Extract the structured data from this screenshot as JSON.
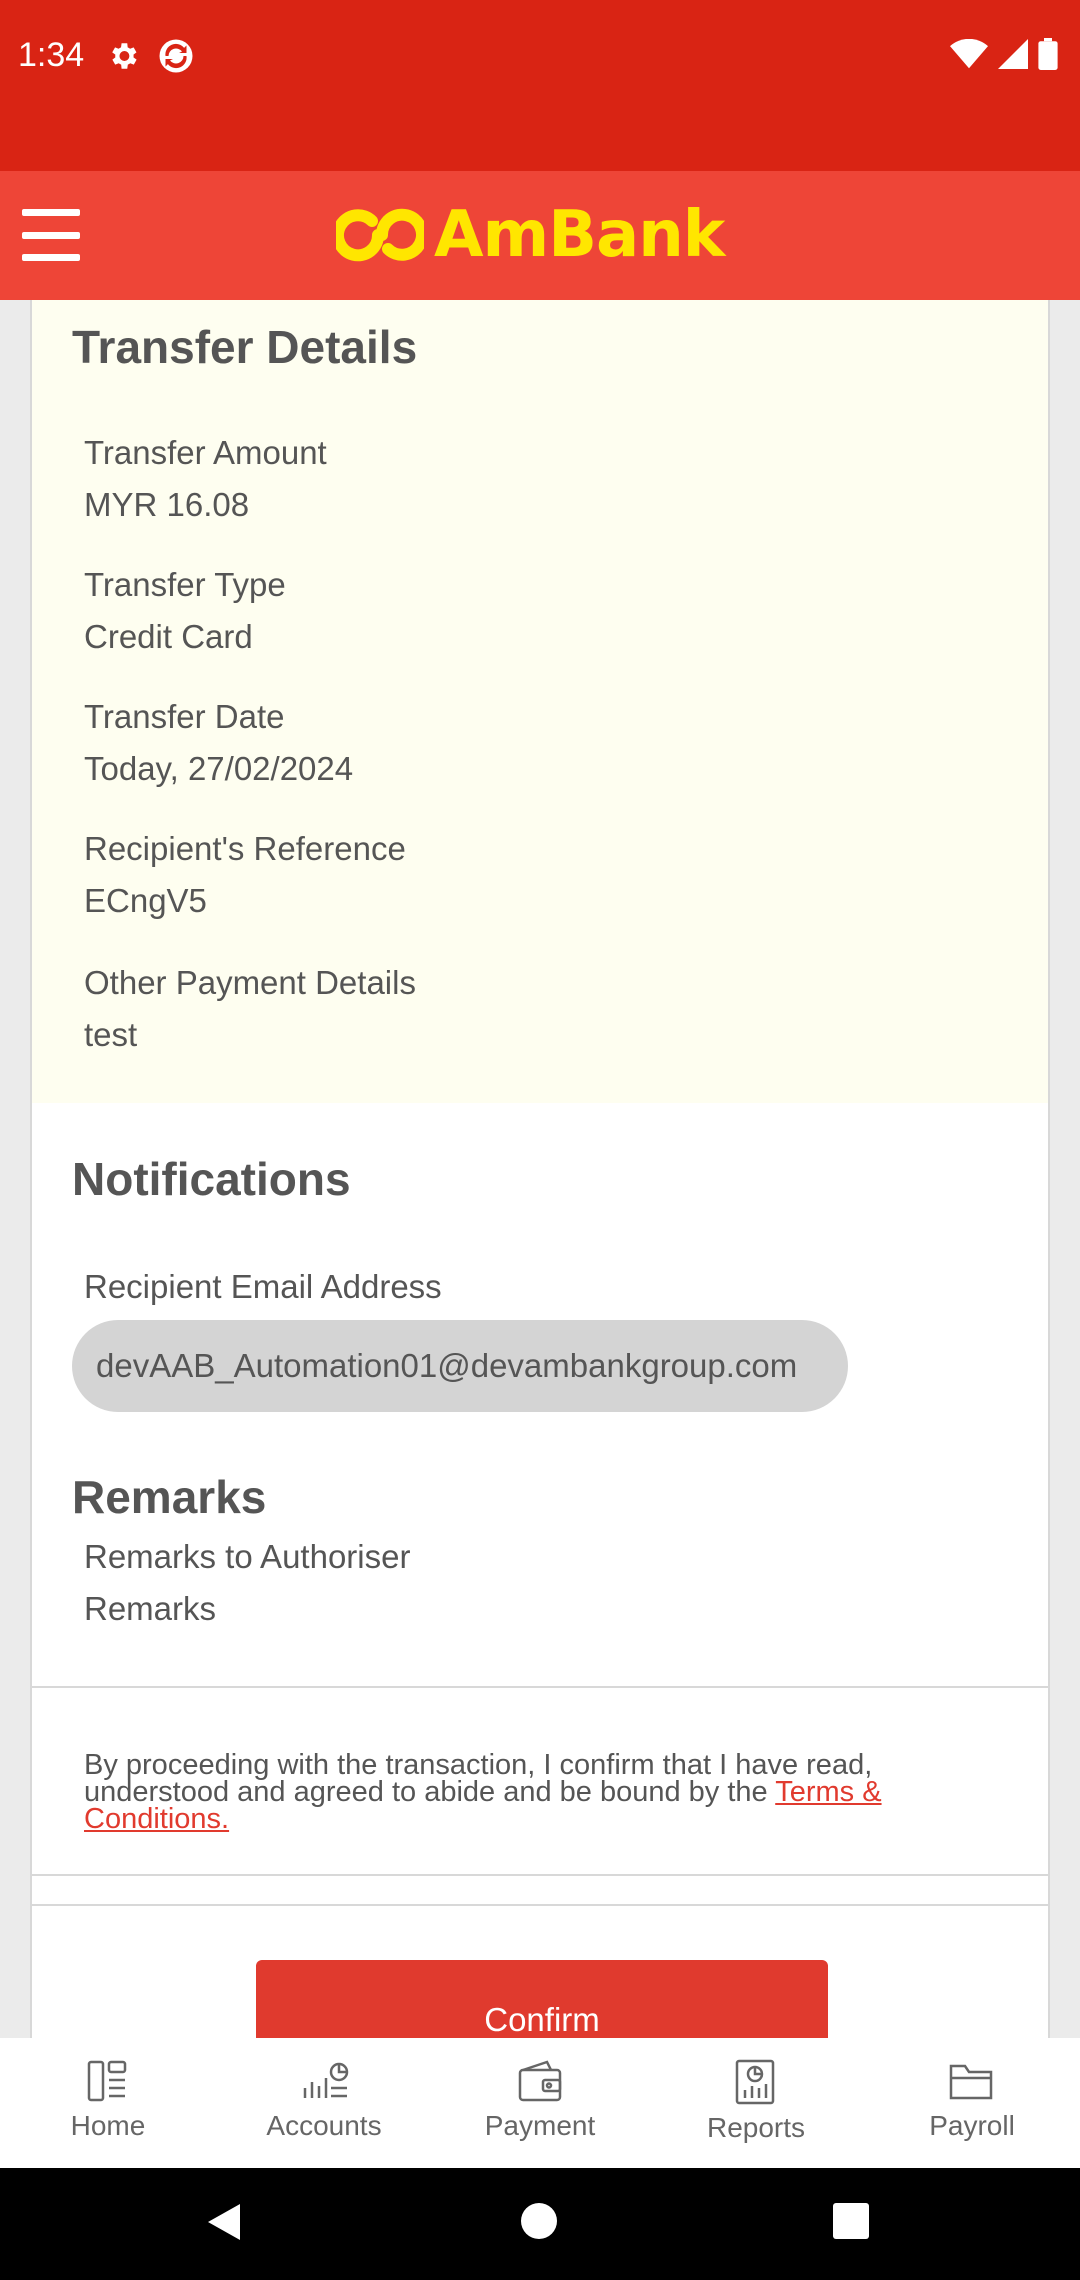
{
  "status_bar": {
    "time": "1:34"
  },
  "app_bar": {
    "logo_text": "AmBank"
  },
  "transfer_details": {
    "title": "Transfer Details",
    "fields": [
      {
        "label": "Transfer Amount",
        "value": "MYR 16.08"
      },
      {
        "label": "Transfer Type",
        "value": "Credit Card"
      },
      {
        "label": "Transfer Date",
        "value": "Today, 27/02/2024"
      },
      {
        "label": "Recipient's Reference",
        "value": "ECngV5"
      },
      {
        "label": "Other Payment Details",
        "value": "test"
      }
    ]
  },
  "notifications": {
    "title": "Notifications",
    "email_label": "Recipient Email Address",
    "email_value": "devAAB_Automation01@devambankgroup.com"
  },
  "remarks": {
    "title": "Remarks",
    "label": "Remarks to Authoriser",
    "value": "Remarks"
  },
  "terms": {
    "text": "By proceeding with the transaction, I confirm that I have read, understood and agreed to abide and be bound by the ",
    "link": "Terms & Conditions."
  },
  "confirm_label": "Confirm",
  "bottom_nav": {
    "items": [
      {
        "label": "Home",
        "icon": "home-icon"
      },
      {
        "label": "Accounts",
        "icon": "accounts-icon"
      },
      {
        "label": "Payment",
        "icon": "payment-icon"
      },
      {
        "label": "Reports",
        "icon": "reports-icon"
      },
      {
        "label": "Payroll",
        "icon": "payroll-icon"
      }
    ]
  },
  "colors": {
    "status_bar": "#d92414",
    "app_bar": "#ee4537",
    "logo": "#ffe600",
    "accent": "#e03a2e",
    "details_bg": "#fefef0"
  }
}
